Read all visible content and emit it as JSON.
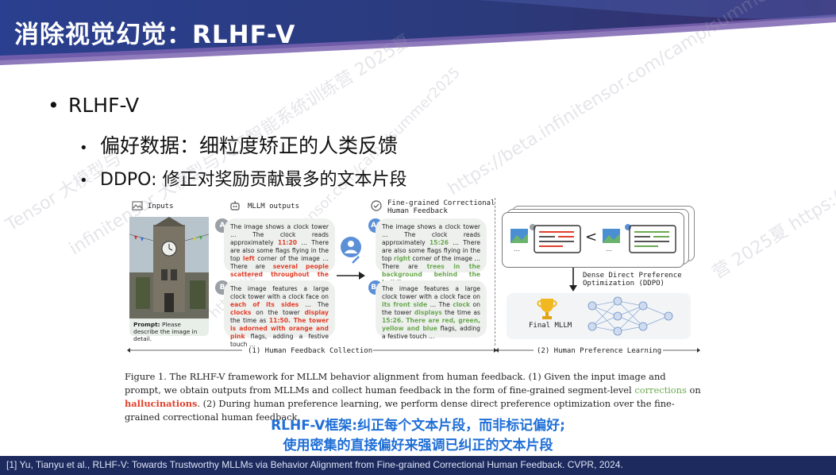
{
  "title": "消除视觉幻觉：RLHF-V",
  "bullets": {
    "level1": "RLHF-V",
    "level2": [
      "偏好数据：细粒度矫正的人类反馈",
      "DDPO: 修正对奖励贡献最多的文本片段"
    ]
  },
  "figure": {
    "inputs_label": "Inputs",
    "mllm_label": "MLLM outputs",
    "feedback_label_1": "Fine-grained Correctional",
    "feedback_label_2": "Human Feedback",
    "prompt_bold": "Prompt:",
    "prompt_text": " Please describe the image in detail.",
    "badge_a": "A",
    "badge_b": "B",
    "badge_a_star": "A*",
    "badge_b_star": "B*",
    "ddpo_label_1": "Dense Direct Preference",
    "ddpo_label_2": "Optimization (DDPO)",
    "final_label": "Final MLLM",
    "less_than": "<",
    "section1": "(1) Human Feedback Collection",
    "section2": "(2) Human Preference Learning"
  },
  "caption": {
    "part1": "Figure 1. The RLHF-V framework for MLLM behavior alignment from human feedback. (1) Given the input image and prompt, we obtain outputs from MLLMs and collect human feedback in the form of fine-grained segment-level ",
    "corrections": "corrections",
    "on": " on ",
    "hallucinations": "hallucinations",
    "part2": ". (2) During human preference learning, we perform dense direct preference optimization over the fine-grained correctional human feedback."
  },
  "note_line1": "RLHF-V框架:纠正每个文本片段，而非标记偏好;",
  "note_line2": "使用密集的直接偏好来强调已纠正的文本片段",
  "footer": "[1] Yu, Tianyu et al., RLHF-V: Towards Trustworthy MLLMs via Behavior Alignment from Fine-grained Correctional Human Feedback. CVPR, 2024.",
  "watermarks": [
    "infinitensor 大模型与人工智能系统训练营 2025夏",
    "https://beta.infinitensor.com/camp/summer2025",
    "营 2025夏 https://be",
    "Tensor 大模型与",
    "https://beta.infinitensor.com/camp/summer2025"
  ],
  "colors": {
    "header": "#2b3a7a",
    "accent_red": "#e0402a",
    "accent_green": "#6aa84f",
    "note_blue": "#1f6fd6",
    "footer": "#1c2a5e"
  }
}
